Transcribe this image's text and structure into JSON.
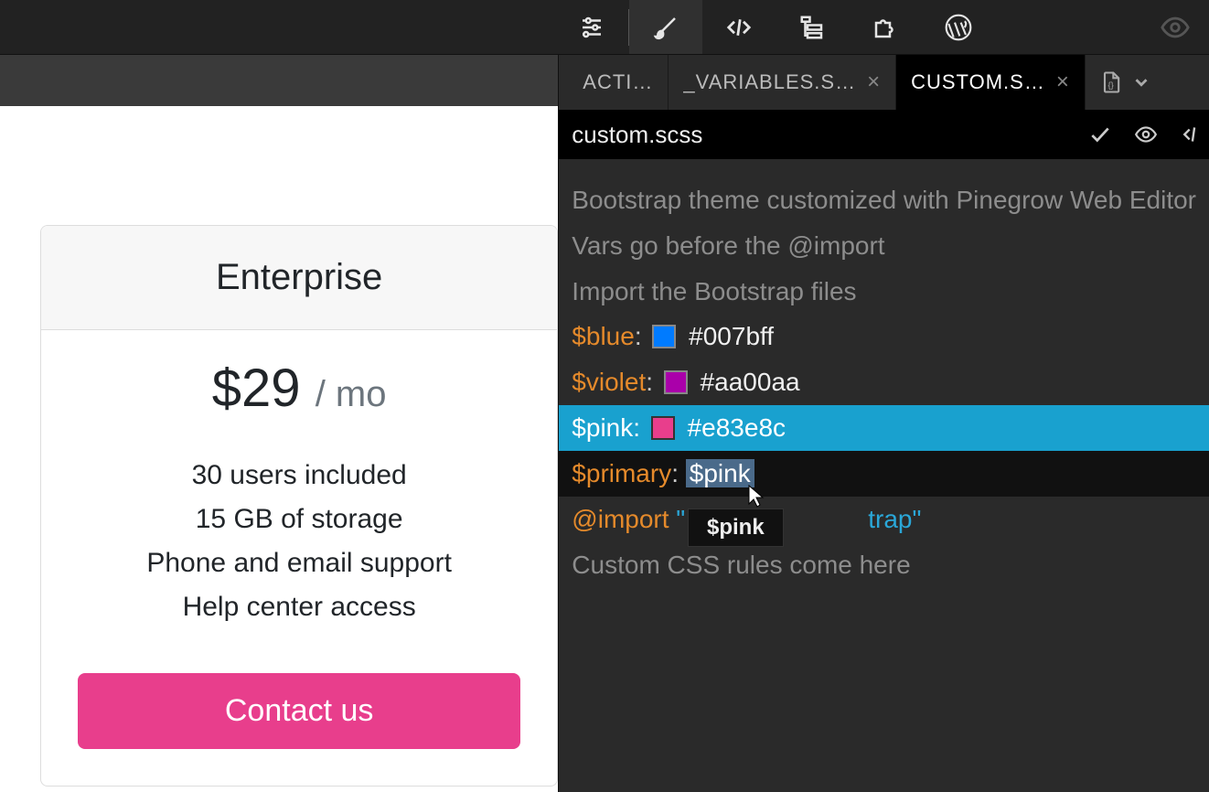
{
  "toolbar": {
    "icons": [
      "sliders",
      "brush",
      "code",
      "tree",
      "puzzle",
      "wordpress"
    ],
    "active": "brush"
  },
  "tabs": {
    "t1": "ACTI…",
    "t2": "_VARIABLES.S…",
    "t3": "CUSTOM.S…"
  },
  "filebar": {
    "filename": "custom.scss"
  },
  "code": {
    "c1": "Bootstrap theme customized with Pinegrow Web Editor",
    "c2": "Vars go before the @import",
    "c3": "Import the Bootstrap files",
    "blue_var": "$blue",
    "blue_val": "#007bff",
    "violet_var": "$violet",
    "violet_val": "#aa00aa",
    "pink_var": "$pink",
    "pink_val": "#e83e8c",
    "primary_var": "$primary",
    "primary_val": "$pink",
    "import_kw": "@import",
    "import_gap": "\"",
    "import_tail": "trap\"",
    "c4": "Custom CSS rules come here",
    "dropdown_val": "$pink"
  },
  "card": {
    "title": "Enterprise",
    "price": "$29",
    "suffix": "/ mo",
    "f1": "30 users included",
    "f2": "15 GB of storage",
    "f3": "Phone and email support",
    "f4": "Help center access",
    "cta": "Contact us"
  },
  "colors": {
    "blue": "#007bff",
    "violet": "#aa00aa",
    "pink": "#e83e8c"
  }
}
